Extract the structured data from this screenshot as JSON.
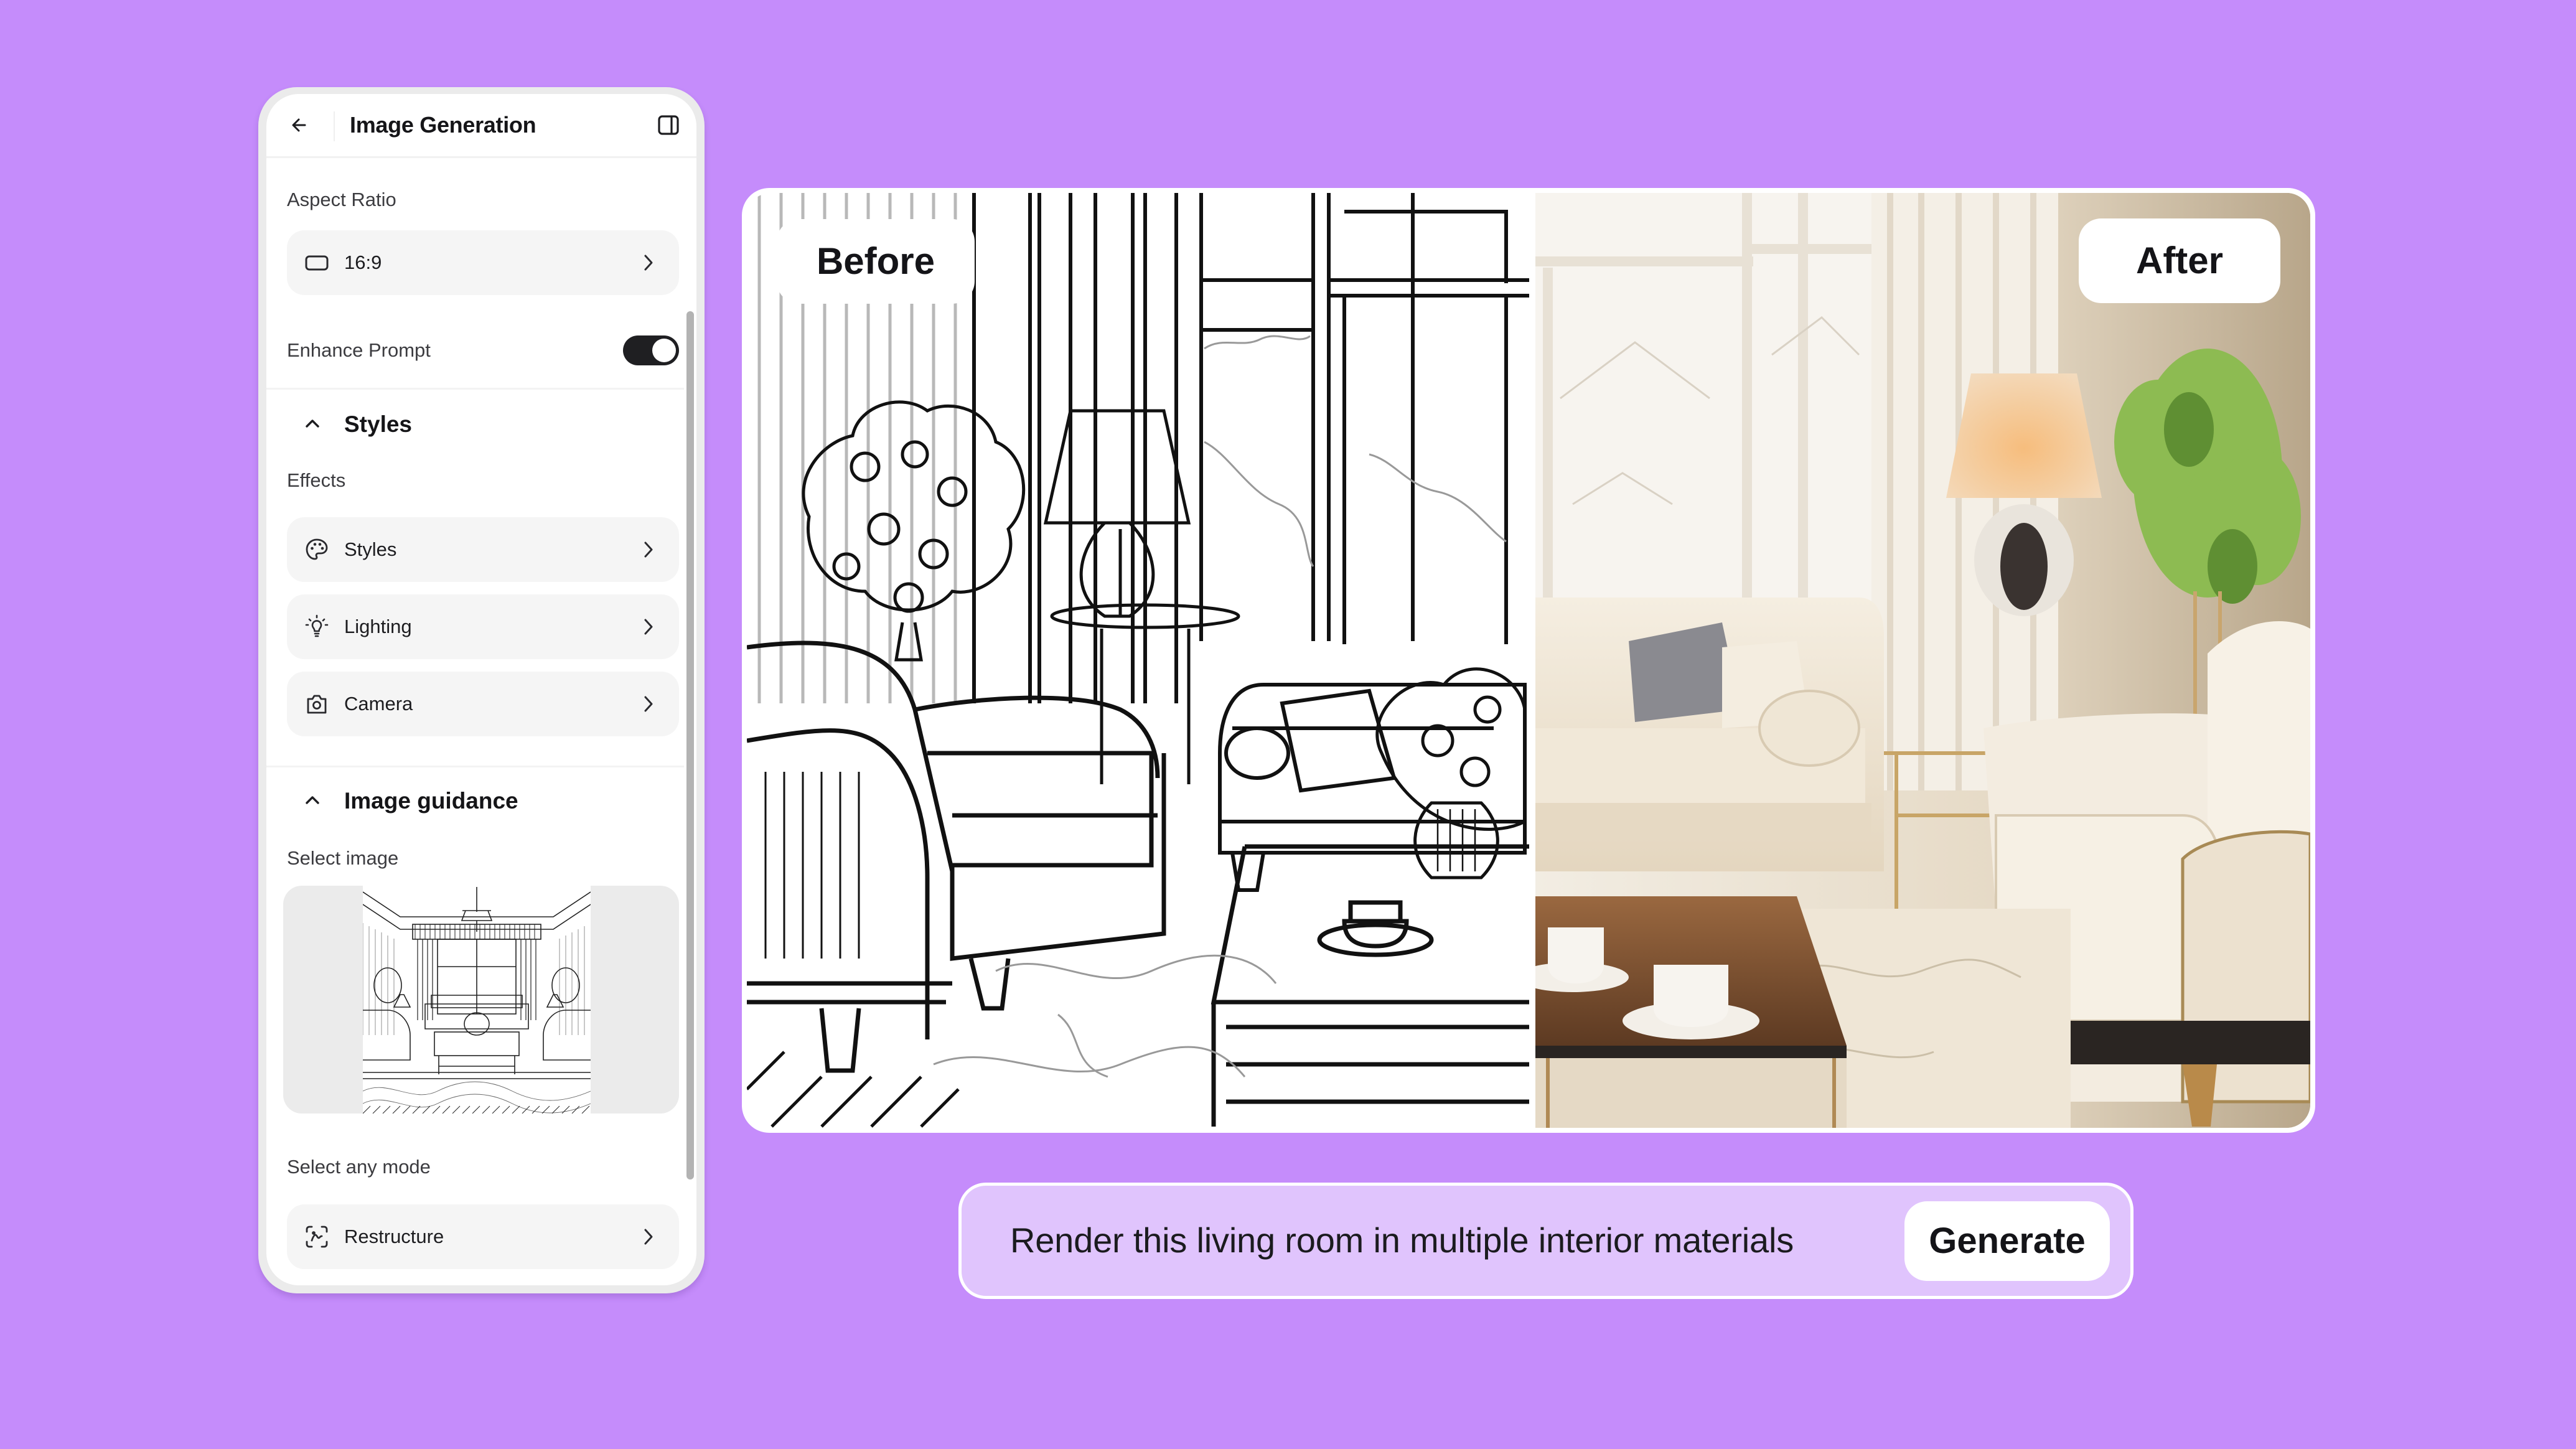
{
  "colors": {
    "background": "#c58cfb",
    "panel_bg": "#ffffff",
    "row_bg": "#f5f5f5",
    "toggle_on": "#1f1f22",
    "prompt_bg": "#e0c4fd",
    "text": "#16161a"
  },
  "panel": {
    "back_icon": "arrow-left-icon",
    "title": "Image Generation",
    "sidebar_toggle_icon": "sidebar-panel-icon",
    "aspect_ratio": {
      "label": "Aspect Ratio",
      "value": "16:9",
      "icon": "rectangle-icon"
    },
    "enhance_prompt": {
      "label": "Enhance Prompt",
      "enabled": true
    },
    "styles_section": {
      "title": "Styles",
      "expanded": true,
      "subtitle": "Effects",
      "items": [
        {
          "label": "Styles",
          "icon": "palette-icon"
        },
        {
          "label": "Lighting",
          "icon": "lightbulb-icon"
        },
        {
          "label": "Camera",
          "icon": "camera-icon"
        }
      ]
    },
    "image_guidance_section": {
      "title": "Image guidance",
      "expanded": true,
      "select_image_label": "Select image",
      "thumbnail_alt": "Line drawing of a living room",
      "mode_label": "Select any mode",
      "mode_value": "Restructure",
      "mode_icon": "scan-face-icon"
    }
  },
  "comparison": {
    "before_label": "Before",
    "after_label": "After"
  },
  "prompt_bar": {
    "text": "Render this living room in multiple interior materials",
    "generate_label": "Generate"
  }
}
